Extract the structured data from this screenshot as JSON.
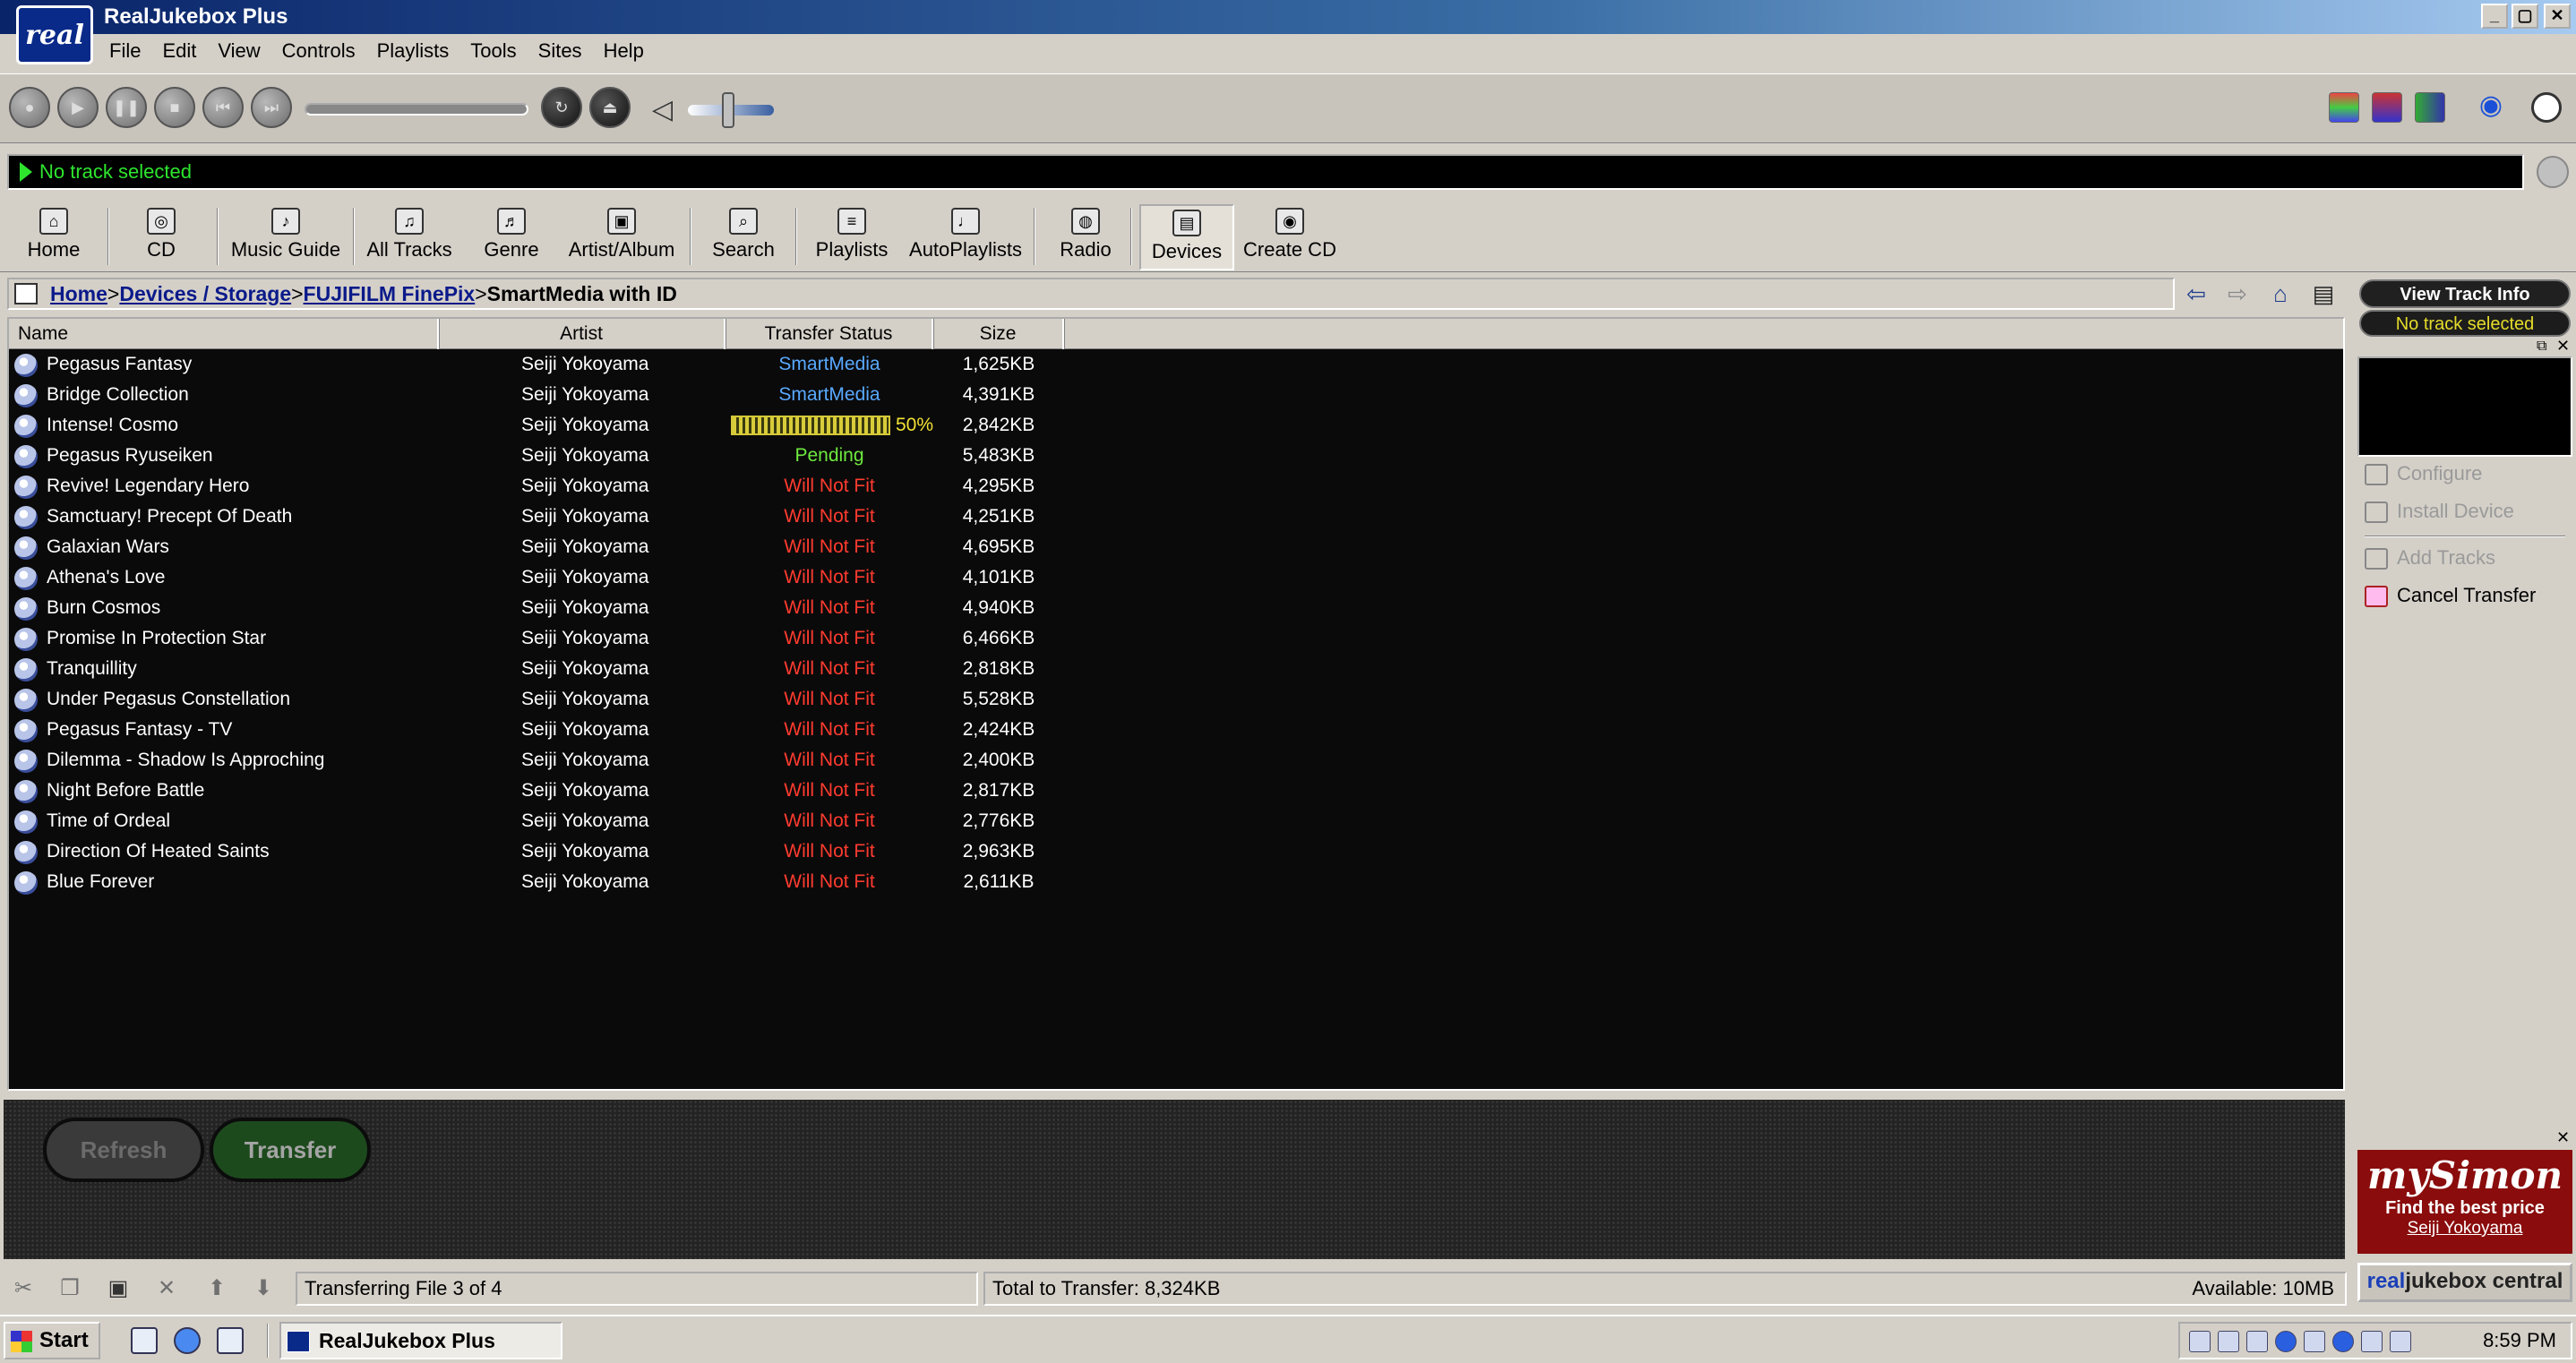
{
  "window": {
    "logo_text": "real",
    "title": "RealJukebox Plus",
    "controls": {
      "minimize": "_",
      "maximize": "▢",
      "close": "✕"
    }
  },
  "menu": [
    "File",
    "Edit",
    "View",
    "Controls",
    "Playlists",
    "Tools",
    "Sites",
    "Help"
  ],
  "transport_icons": [
    "record-icon",
    "play-icon",
    "pause-icon",
    "stop-icon",
    "previous-icon",
    "next-icon",
    "shuffle-icon",
    "eject-icon",
    "speaker-icon"
  ],
  "status": {
    "now_playing": "No track selected"
  },
  "nav": {
    "items": [
      {
        "label": "Home",
        "icon": "home-icon",
        "glyph": "⌂"
      },
      {
        "label": "CD",
        "icon": "cd-icon",
        "glyph": "◎"
      },
      {
        "label": "Music Guide",
        "icon": "music-guide-icon",
        "glyph": "♪"
      },
      {
        "label": "All Tracks",
        "icon": "all-tracks-icon",
        "glyph": "♫"
      },
      {
        "label": "Genre",
        "icon": "genre-icon",
        "glyph": "♬"
      },
      {
        "label": "Artist/Album",
        "icon": "artist-album-icon",
        "glyph": "▣"
      },
      {
        "label": "Search",
        "icon": "search-icon",
        "glyph": "⌕"
      },
      {
        "label": "Playlists",
        "icon": "playlists-icon",
        "glyph": "≡"
      },
      {
        "label": "AutoPlaylists",
        "icon": "autoplaylists-icon",
        "glyph": "♩"
      },
      {
        "label": "Radio",
        "icon": "radio-icon",
        "glyph": "◍"
      },
      {
        "label": "Devices",
        "icon": "devices-icon",
        "glyph": "▤"
      },
      {
        "label": "Create CD",
        "icon": "create-cd-icon",
        "glyph": "◉"
      }
    ],
    "active": "Devices"
  },
  "breadcrumb": {
    "links": [
      "Home",
      "Devices / Storage",
      "FUJIFILM FinePix"
    ],
    "separator": ">",
    "current": "SmartMedia with ID"
  },
  "table": {
    "columns": [
      "Name",
      "Artist",
      "Transfer Status",
      "Size"
    ],
    "rows": [
      {
        "name": "Pegasus Fantasy",
        "artist": "Seiji Yokoyama",
        "status": "SmartMedia",
        "status_type": "smart",
        "size": "1,625KB"
      },
      {
        "name": "Bridge Collection",
        "artist": "Seiji Yokoyama",
        "status": "SmartMedia",
        "status_type": "smart",
        "size": "4,391KB"
      },
      {
        "name": "Intense! Cosmo",
        "artist": "Seiji Yokoyama",
        "status": "50%",
        "status_type": "progress",
        "progress": 0.5,
        "size": "2,842KB"
      },
      {
        "name": "Pegasus Ryuseiken",
        "artist": "Seiji Yokoyama",
        "status": "Pending",
        "status_type": "pending",
        "size": "5,483KB"
      },
      {
        "name": "Revive! Legendary Hero",
        "artist": "Seiji Yokoyama",
        "status": "Will Not Fit",
        "status_type": "nofit",
        "size": "4,295KB"
      },
      {
        "name": "Samctuary! Precept Of Death",
        "artist": "Seiji Yokoyama",
        "status": "Will Not Fit",
        "status_type": "nofit",
        "size": "4,251KB"
      },
      {
        "name": "Galaxian Wars",
        "artist": "Seiji Yokoyama",
        "status": "Will Not Fit",
        "status_type": "nofit",
        "size": "4,695KB"
      },
      {
        "name": "Athena's Love",
        "artist": "Seiji Yokoyama",
        "status": "Will Not Fit",
        "status_type": "nofit",
        "size": "4,101KB"
      },
      {
        "name": "Burn Cosmos",
        "artist": "Seiji Yokoyama",
        "status": "Will Not Fit",
        "status_type": "nofit",
        "size": "4,940KB"
      },
      {
        "name": "Promise In Protection Star",
        "artist": "Seiji Yokoyama",
        "status": "Will Not Fit",
        "status_type": "nofit",
        "size": "6,466KB"
      },
      {
        "name": "Tranquillity",
        "artist": "Seiji Yokoyama",
        "status": "Will Not Fit",
        "status_type": "nofit",
        "size": "2,818KB"
      },
      {
        "name": "Under Pegasus Constellation",
        "artist": "Seiji Yokoyama",
        "status": "Will Not Fit",
        "status_type": "nofit",
        "size": "5,528KB"
      },
      {
        "name": "Pegasus Fantasy - TV",
        "artist": "Seiji Yokoyama",
        "status": "Will Not Fit",
        "status_type": "nofit",
        "size": "2,424KB"
      },
      {
        "name": "Dilemma - Shadow Is Approching",
        "artist": "Seiji Yokoyama",
        "status": "Will Not Fit",
        "status_type": "nofit",
        "size": "2,400KB"
      },
      {
        "name": "Night Before Battle",
        "artist": "Seiji Yokoyama",
        "status": "Will Not Fit",
        "status_type": "nofit",
        "size": "2,817KB"
      },
      {
        "name": "Time of Ordeal",
        "artist": "Seiji Yokoyama",
        "status": "Will Not Fit",
        "status_type": "nofit",
        "size": "2,776KB"
      },
      {
        "name": "Direction Of Heated Saints",
        "artist": "Seiji Yokoyama",
        "status": "Will Not Fit",
        "status_type": "nofit",
        "size": "2,963KB"
      },
      {
        "name": "Blue Forever",
        "artist": "Seiji Yokoyama",
        "status": "Will Not Fit",
        "status_type": "nofit",
        "size": "2,611KB"
      }
    ]
  },
  "actions": {
    "refresh_label": "Refresh",
    "transfer_label": "Transfer"
  },
  "bottom_status": {
    "transferring": "Transferring File 3 of 4",
    "total": "Total to Transfer: 8,324KB",
    "available": "Available: 10MB",
    "icons": [
      "cut-icon",
      "copy-icon",
      "paste-icon",
      "delete-icon",
      "move-up-icon",
      "move-down-icon"
    ]
  },
  "right_panel": {
    "view_track_info": "View Track Info",
    "status": "No track selected",
    "menu": [
      {
        "label": "Configure",
        "enabled": false
      },
      {
        "label": "Install Device",
        "enabled": false
      },
      {
        "label": "Add Tracks",
        "enabled": false
      },
      {
        "label": "Cancel Transfer",
        "enabled": true
      }
    ],
    "ad": {
      "brand": "mySimon",
      "tagline": "Find the best price",
      "link": "Seiji Yokoyama"
    },
    "central_real": "real",
    "central_rest": "jukebox central"
  },
  "taskbar": {
    "start": "Start",
    "task": "RealJukebox Plus",
    "clock": "8:59 PM"
  },
  "colors": {
    "smartmedia": "#59a9ff",
    "pending": "#6eea3e",
    "will_not_fit": "#ff3b2f",
    "progress": "#f2e234",
    "status_text": "#2ee52e"
  }
}
